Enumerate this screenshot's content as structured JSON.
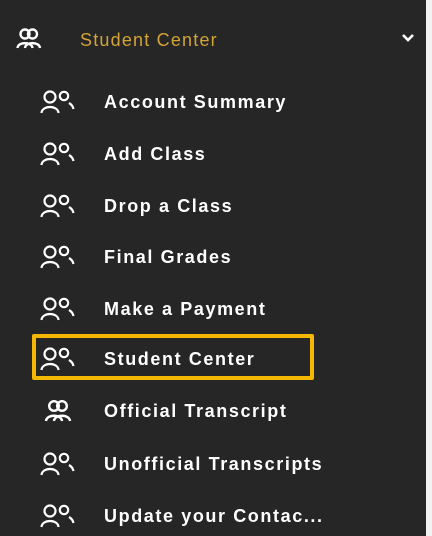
{
  "menu": {
    "header": {
      "label": "Student Center",
      "icon": "users-icon",
      "toggle_icon": "chevron-down-icon",
      "accent_color": "#d4a338"
    },
    "items": [
      {
        "label": "Account Summary",
        "icon": "users-icon"
      },
      {
        "label": "Add Class",
        "icon": "users-icon"
      },
      {
        "label": "Drop a Class",
        "icon": "users-icon"
      },
      {
        "label": "Final Grades",
        "icon": "users-icon"
      },
      {
        "label": "Make a Payment",
        "icon": "users-icon"
      },
      {
        "label": "Student Center",
        "icon": "users-icon",
        "highlighted": true
      },
      {
        "label": "Official Transcript",
        "icon": "user-group-icon"
      },
      {
        "label": "Unofficial Transcripts",
        "icon": "users-icon"
      },
      {
        "label": "Update your Contac...",
        "icon": "users-icon"
      }
    ],
    "highlight_color": "#f5b800",
    "background_color": "#262626"
  }
}
